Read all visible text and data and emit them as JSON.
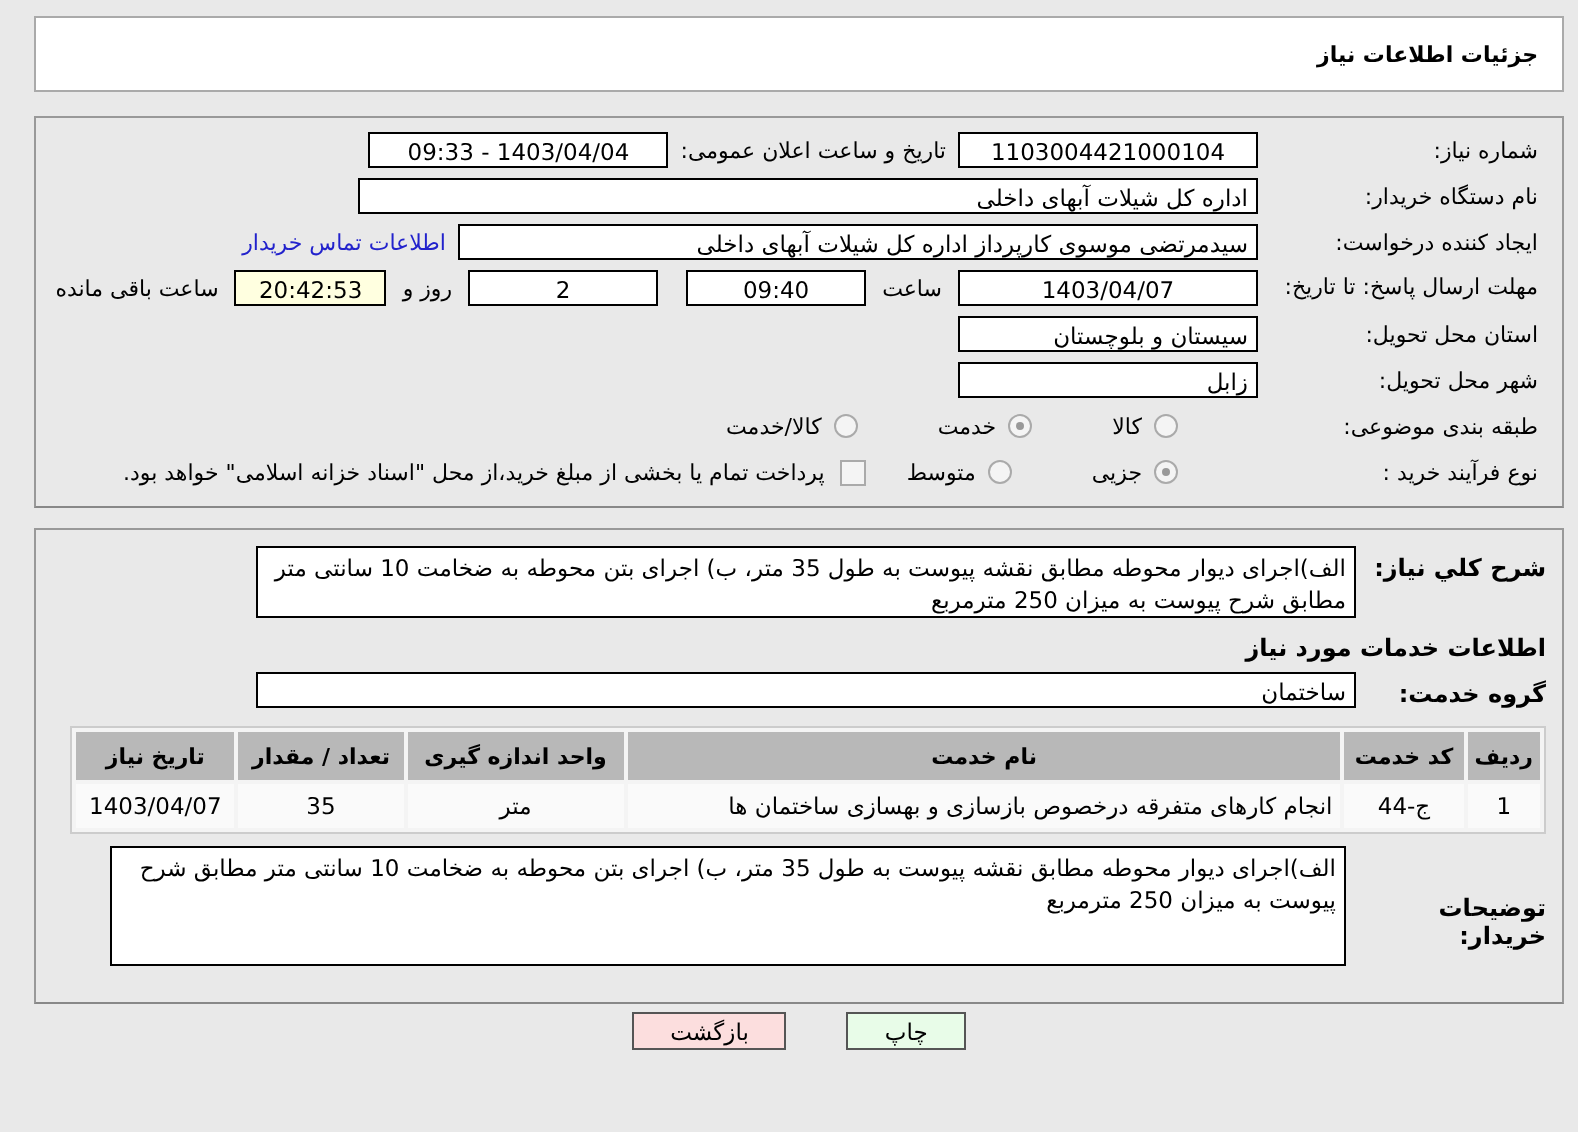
{
  "header": {
    "title": "جزئیات اطلاعات نیاز"
  },
  "fields": {
    "need_number": {
      "label": "شماره نیاز:",
      "value": "1103004421000104"
    },
    "announce": {
      "label": "تاریخ و ساعت اعلان عمومی:",
      "value": "1403/04/04 - 09:33"
    },
    "buyer": {
      "label": "نام دستگاه خریدار:",
      "value": "اداره کل شیلات آبهای داخلی"
    },
    "creator": {
      "label": "ایجاد کننده درخواست:",
      "value": "سیدمرتضی موسوی کارپرداز اداره کل شیلات آبهای داخلی",
      "link": "اطلاعات تماس خریدار"
    },
    "deadline": {
      "label": "مهلت ارسال پاسخ: تا تاریخ:",
      "date": "1403/04/07",
      "time_label": "ساعت",
      "time": "09:40",
      "days": "2",
      "days_label": "روز و",
      "remaining": "20:42:53",
      "remaining_label": "ساعت باقی مانده"
    },
    "province": {
      "label": "استان محل تحویل:",
      "value": "سیستان و بلوچستان"
    },
    "city": {
      "label": "شهر محل تحویل:",
      "value": "زابل"
    },
    "category": {
      "label": "طبقه بندی موضوعی:",
      "options": [
        {
          "label": "کالا",
          "selected": false
        },
        {
          "label": "خدمت",
          "selected": true
        },
        {
          "label": "کالا/خدمت",
          "selected": false
        }
      ]
    },
    "process": {
      "label": "نوع فرآیند خرید :",
      "options": [
        {
          "label": "جزیی",
          "selected": true
        },
        {
          "label": "متوسط",
          "selected": false
        }
      ],
      "payment": {
        "label": "پرداخت تمام یا بخشی از مبلغ خرید،از محل \"اسناد خزانه اسلامی\" خواهد بود.",
        "checked": false
      }
    }
  },
  "description": {
    "label": "شرح کلي نياز:",
    "value": "الف)اجرای دیوار محوطه مطابق نقشه پیوست به طول 35 متر، ب) اجرای بتن محوطه به ضخامت 10 سانتی متر مطابق شرح پیوست به میزان 250 مترمربع"
  },
  "services": {
    "title": "اطلاعات خدمات مورد نیاز",
    "group_label": "گروه خدمت:",
    "group": "ساختمان",
    "table": {
      "columns": [
        "ردیف",
        "کد خدمت",
        "نام خدمت",
        "واحد اندازه گیری",
        "تعداد / مقدار",
        "تاریخ نیاز"
      ],
      "rows": [
        [
          "1",
          "ج-44",
          "انجام کارهای متفرقه درخصوص بازسازی و بهسازی ساختمان ها",
          "متر",
          "35",
          "1403/04/07"
        ]
      ]
    }
  },
  "buyer_notes": {
    "label": "توضیحات خریدار:",
    "value": "الف)اجرای دیوار محوطه مطابق نقشه پیوست به طول 35 متر، ب) اجرای بتن محوطه به ضخامت 10 سانتی متر مطابق شرح پیوست به میزان 250 مترمربع"
  },
  "buttons": [
    {
      "label": "چاپ",
      "kind": "print"
    },
    {
      "label": "بازگشت",
      "kind": "back"
    }
  ]
}
